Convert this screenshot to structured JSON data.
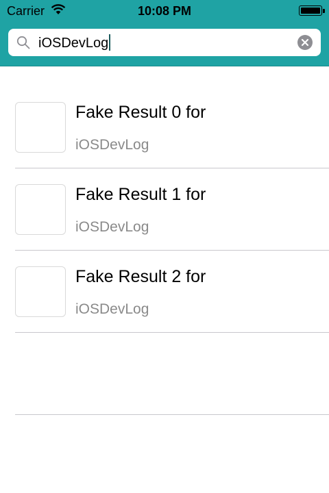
{
  "status_bar": {
    "carrier": "Carrier",
    "time": "10:08 PM",
    "wifi_icon": "wifi-icon",
    "battery_icon": "battery-icon"
  },
  "search": {
    "query": "iOSDevLog",
    "search_icon": "search-icon",
    "clear_icon": "clear-icon"
  },
  "colors": {
    "header_bg": "#1fa3a4",
    "subtitle": "#8a8a8a",
    "separator": "#c8c7cc"
  },
  "results": [
    {
      "title": "Fake Result 0 for",
      "subtitle": "iOSDevLog"
    },
    {
      "title": "Fake Result 1 for",
      "subtitle": "iOSDevLog"
    },
    {
      "title": "Fake Result 2 for",
      "subtitle": "iOSDevLog"
    }
  ]
}
